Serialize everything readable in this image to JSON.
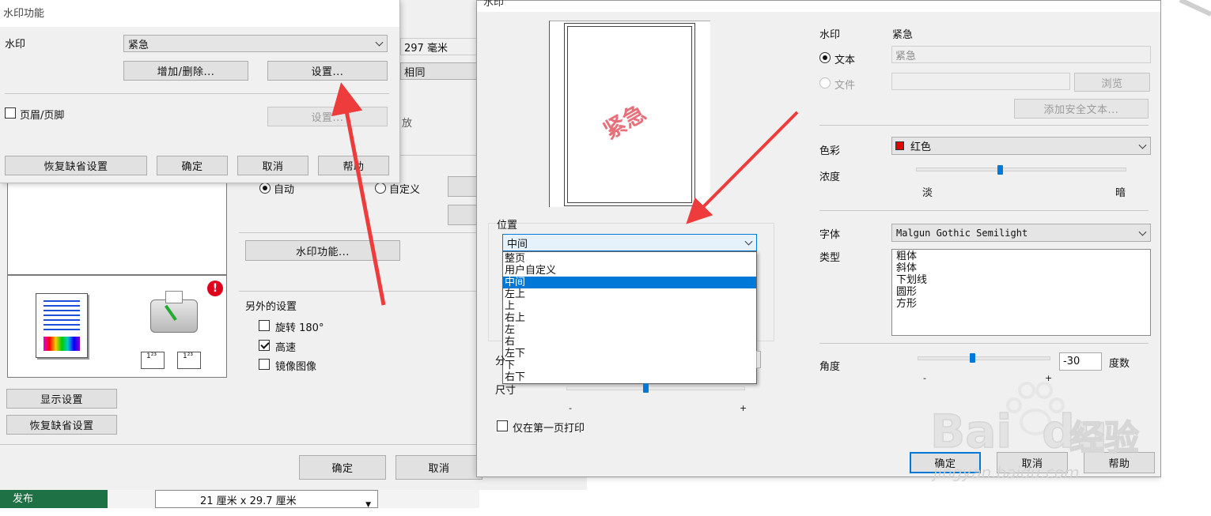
{
  "left_dialog": {
    "title": "水印功能",
    "watermark_label": "水印",
    "watermark_value": "紧急",
    "add_remove_button": "增加/删除...",
    "settings_button": "设置...",
    "header_footer_label": "页眉/页脚",
    "header_footer_settings_button": "设置...",
    "restore_button": "恢复缺省设置",
    "ok_button": "确定",
    "cancel_button": "取消",
    "help_button": "帮助"
  },
  "back_window": {
    "size_text": "297 毫米",
    "same_text": "相同",
    "scale_text": "放",
    "auto_radio": "自动",
    "custom_radio": "自定义",
    "watermark_button": "水印功能...",
    "other_settings_title": "另外的设置",
    "rotate_label": "旋转 180°",
    "highspeed_label": "高速",
    "mirror_label": "镜像图像",
    "show_settings_button": "显示设置",
    "restore_button": "恢复缺省设置",
    "ok_button": "确定",
    "cancel_button": "取消",
    "paper_size": "21 厘米 x 29.7 厘米",
    "publish_label": "发布",
    "warning_icon": "exclamation"
  },
  "settings_dialog": {
    "title": "水印",
    "preview_text": "紧急",
    "preview_color": "#e8707a",
    "watermark_label": "水印",
    "watermark_value": "紧急",
    "text_radio": "文本",
    "text_value": "紧急",
    "file_radio": "文件",
    "browse_button": "浏览",
    "add_secure_text_button": "添加安全文本...",
    "color_label": "色彩",
    "color_value": "红色",
    "color_swatch": "#e00000",
    "density_label": "浓度",
    "density_light": "淡",
    "density_dark": "暗",
    "density_level": 0.4,
    "font_label": "字体",
    "font_value": "Malgun Gothic Semilight",
    "type_label": "类型",
    "type_options": [
      "粗体",
      "斜体",
      "下划线",
      "圆形",
      "方形"
    ],
    "angle_label": "角度",
    "angle_value": "-30",
    "angle_unit": "度数",
    "angle_minus": "-",
    "angle_plus": "+",
    "position_label": "位置",
    "position_selected": "中间",
    "position_options": [
      "整页",
      "用户自定义",
      "中间",
      "左上",
      "上",
      "右上",
      "左",
      "右",
      "左下",
      "下",
      "右下"
    ],
    "position_selected_index": 2,
    "size_label": "尺寸",
    "size_minus": "-",
    "size_plus": "+",
    "partial_label": "分",
    "first_page_only_label": "仅在第一页打印",
    "ok_button": "确定",
    "cancel_button": "取消",
    "help_button": "帮助"
  },
  "overlay": {
    "arrow_color": "#ee3b3b",
    "brand_text": "Bai",
    "brand_text2": "du",
    "brand_cn": "经验",
    "brand_url": "jingyan.baidu.com"
  }
}
